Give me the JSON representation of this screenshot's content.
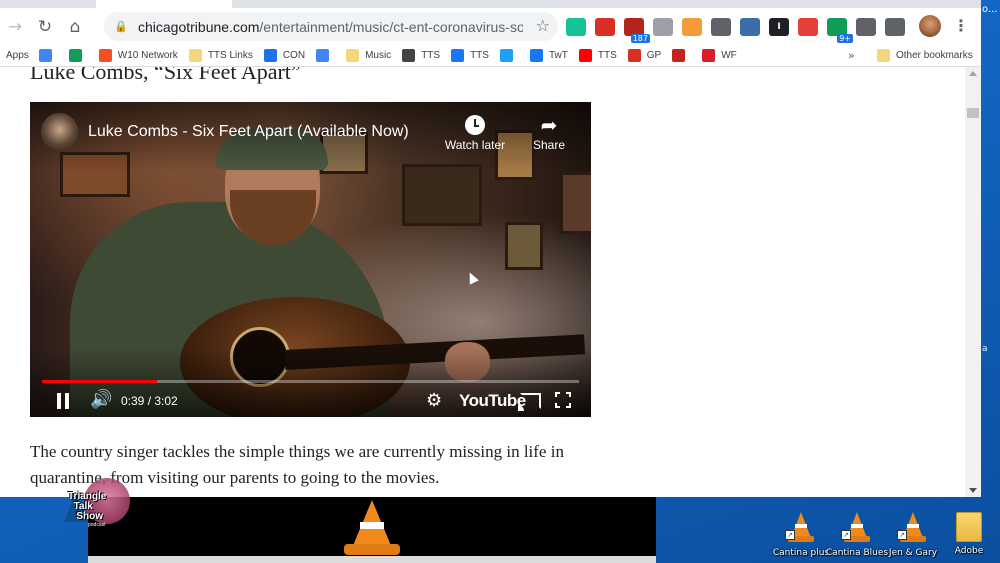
{
  "desktop": {
    "edge_text_top": "o...",
    "edge_text_mid": "a",
    "icons": [
      {
        "label": "Cantina plus"
      },
      {
        "label": "Cantina Blues"
      },
      {
        "label": "Jen & Gary"
      },
      {
        "label": "Adobe"
      }
    ]
  },
  "browser": {
    "url_host": "chicagotribune.com",
    "url_path": "/entertainment/music/ct-ent-coronavirus-song...",
    "extensions": [
      {
        "icon": "grammarly-icon",
        "color": "#15c39a",
        "text": ""
      },
      {
        "icon": "gmail-icon",
        "color": "#d93025",
        "text": ""
      },
      {
        "icon": "calendar-icon",
        "color": "#b3261e",
        "badge": "187"
      },
      {
        "icon": "comment-icon",
        "color": "#9aa0a6",
        "text": ""
      },
      {
        "icon": "rss-icon",
        "color": "#f29b38",
        "text": ""
      },
      {
        "icon": "pin-icon",
        "color": "#5f6368",
        "text": ""
      },
      {
        "icon": "clipboard-icon",
        "color": "#3b6ea8",
        "text": ""
      },
      {
        "icon": "info-icon",
        "color": "#202124",
        "text": "I"
      },
      {
        "icon": "pdf-icon",
        "color": "#e6403a",
        "text": ""
      },
      {
        "icon": "chat-icon",
        "color": "#0f9d58",
        "badge": "9+"
      },
      {
        "icon": "puzzle-icon",
        "color": "#5f6368",
        "text": ""
      },
      {
        "icon": "playlist-icon",
        "color": "#5f6368",
        "text": ""
      }
    ],
    "bookmarks": [
      {
        "label": "Apps",
        "icon": "apps-grid-icon",
        "color": "#5f6368"
      },
      {
        "label": "",
        "icon": "google-icon",
        "color": "#4285f4"
      },
      {
        "label": "",
        "icon": "drive-icon",
        "color": "#0f9d58"
      },
      {
        "label": "W10 Network",
        "icon": "windows-icon",
        "color": "#f25022"
      },
      {
        "label": "TTS Links",
        "icon": "folder-icon",
        "color": "#f6d67a"
      },
      {
        "label": "CON",
        "icon": "user-circle-icon",
        "color": "#1a73e8"
      },
      {
        "label": "",
        "icon": "calendar-icon",
        "color": "#4285f4"
      },
      {
        "label": "Music",
        "icon": "folder-icon",
        "color": "#f6d67a"
      },
      {
        "label": "TTS",
        "icon": "news-icon",
        "color": "#444"
      },
      {
        "label": "TTS",
        "icon": "facebook-icon",
        "color": "#1877f2"
      },
      {
        "label": "",
        "icon": "twitter-icon",
        "color": "#1da1f2"
      },
      {
        "label": "TwT",
        "icon": "facebook-icon",
        "color": "#1877f2"
      },
      {
        "label": "TTS",
        "icon": "youtube-icon",
        "color": "#ff0000"
      },
      {
        "label": "GP",
        "icon": "gmail-icon",
        "color": "#d93025"
      },
      {
        "label": "",
        "icon": "wand-icon",
        "color": "#c5221f"
      },
      {
        "label": "WF",
        "icon": "wellsfargo-icon",
        "color": "#d71e28"
      }
    ],
    "bookmarks_more": "»",
    "other_bookmarks": "Other bookmarks"
  },
  "article": {
    "cut_heading": "Luke Combs, “Six Feet Apart”",
    "paragraph": "The country singer tackles the simple things we are currently missing in life in quarantine, from visiting our parents to going to the movies."
  },
  "video": {
    "title": "Luke Combs - Six Feet Apart (Available Now)",
    "watch_later": "Watch later",
    "share": "Share",
    "time_current": "0:39",
    "time_total": "3:02",
    "progress_fraction": 0.214,
    "platform_logo": "YouTube",
    "accent": "#ff0000"
  },
  "overlay": {
    "logo_text_1": "Triangle",
    "logo_text_2": "Talk",
    "logo_text_3": "Show",
    "logo_sub": "podcast"
  }
}
